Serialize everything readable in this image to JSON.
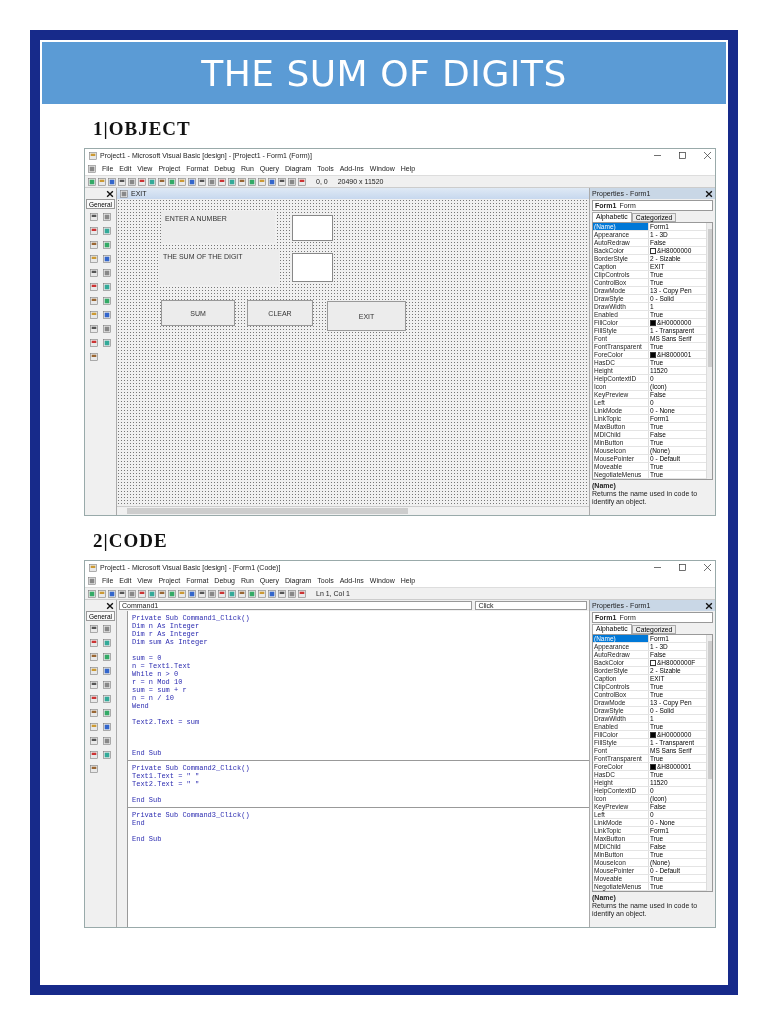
{
  "banner": {
    "title": "THE SUM OF DIGITS"
  },
  "sections": [
    {
      "heading": "1|OBJECT",
      "ide": {
        "kind": "form",
        "title": "Project1 - Microsoft Visual Basic [design] - [Project1 - Form1 (Form)]",
        "menu": [
          "File",
          "Edit",
          "View",
          "Project",
          "Format",
          "Debug",
          "Run",
          "Query",
          "Diagram",
          "Tools",
          "Add-Ins",
          "Window",
          "Help"
        ],
        "status": [
          "0, 0",
          "20490 x 11520"
        ],
        "toolbox_tab": "General",
        "form": {
          "caption": "EXIT",
          "controls": [
            {
              "kind": "label",
              "text": "ENTER A NUMBER"
            },
            {
              "kind": "textbox"
            },
            {
              "kind": "label",
              "text": "THE SUM OF THE DIGIT"
            },
            {
              "kind": "textbox"
            },
            {
              "kind": "button",
              "text": "SUM"
            },
            {
              "kind": "button",
              "text": "CLEAR"
            },
            {
              "kind": "button",
              "text": "EXIT"
            }
          ]
        },
        "properties": {
          "title": "Properties - Form1",
          "object": "Form1",
          "object_type": "Form",
          "tabs": [
            {
              "label": "Alphabetic",
              "selected": true
            },
            {
              "label": "Categorized",
              "selected": false
            }
          ],
          "rows": [
            {
              "name": "(Name)",
              "value": "Form1",
              "selected": true
            },
            {
              "name": "Appearance",
              "value": "1 - 3D",
              "selected": false
            },
            {
              "name": "AutoRedraw",
              "value": "False",
              "selected": false
            },
            {
              "name": "BackColor",
              "value": "&H8000000",
              "color": "#ffffff",
              "selected": false
            },
            {
              "name": "BorderStyle",
              "value": "2 - Sizable",
              "selected": false
            },
            {
              "name": "Caption",
              "value": "EXIT",
              "selected": false
            },
            {
              "name": "ClipControls",
              "value": "True",
              "selected": false
            },
            {
              "name": "ControlBox",
              "value": "True",
              "selected": false
            },
            {
              "name": "DrawMode",
              "value": "13 - Copy Pen",
              "selected": false
            },
            {
              "name": "DrawStyle",
              "value": "0 - Solid",
              "selected": false
            },
            {
              "name": "DrawWidth",
              "value": "1",
              "selected": false
            },
            {
              "name": "Enabled",
              "value": "True",
              "selected": false
            },
            {
              "name": "FillColor",
              "value": "&H0000000",
              "color": "#000000",
              "selected": false
            },
            {
              "name": "FillStyle",
              "value": "1 - Transparent",
              "selected": false
            },
            {
              "name": "Font",
              "value": "MS Sans Serif",
              "selected": false
            },
            {
              "name": "FontTransparent",
              "value": "True",
              "selected": false
            },
            {
              "name": "ForeColor",
              "value": "&H8000001",
              "color": "#000000",
              "selected": false
            },
            {
              "name": "HasDC",
              "value": "True",
              "selected": false
            },
            {
              "name": "Height",
              "value": "11520",
              "selected": false
            },
            {
              "name": "HelpContextID",
              "value": "0",
              "selected": false
            },
            {
              "name": "Icon",
              "value": "(Icon)",
              "selected": false
            },
            {
              "name": "KeyPreview",
              "value": "False",
              "selected": false
            },
            {
              "name": "Left",
              "value": "0",
              "selected": false
            },
            {
              "name": "LinkMode",
              "value": "0 - None",
              "selected": false
            },
            {
              "name": "LinkTopic",
              "value": "Form1",
              "selected": false
            },
            {
              "name": "MaxButton",
              "value": "True",
              "selected": false
            },
            {
              "name": "MDIChild",
              "value": "False",
              "selected": false
            },
            {
              "name": "MinButton",
              "value": "True",
              "selected": false
            },
            {
              "name": "MouseIcon",
              "value": "(None)",
              "selected": false
            },
            {
              "name": "MousePointer",
              "value": "0 - Default",
              "selected": false
            },
            {
              "name": "Moveable",
              "value": "True",
              "selected": false
            },
            {
              "name": "NegotiateMenus",
              "value": "True",
              "selected": false
            }
          ],
          "description_title": "(Name)",
          "description": "Returns the name used in code to identify an object."
        }
      }
    },
    {
      "heading": "2|CODE",
      "ide": {
        "kind": "code",
        "title": "Project1 - Microsoft Visual Basic [design] - [Form1 (Code)]",
        "menu": [
          "File",
          "Edit",
          "View",
          "Project",
          "Format",
          "Debug",
          "Run",
          "Query",
          "Diagram",
          "Tools",
          "Add-Ins",
          "Window",
          "Help"
        ],
        "status": [
          "Ln 1, Col 1"
        ],
        "toolbox_tab": "General",
        "code": {
          "object": "Command1",
          "procedure": "Click",
          "blocks": [
            {
              "paragraphs": [
                [
                  "Private Sub Command1_Click()",
                  "Dim n As Integer",
                  "Dim r As Integer",
                  "Dim sum As Integer"
                ],
                [
                  "sum = 0",
                  "n = Text1.Text",
                  "While n > 0",
                  "r = n Mod 10",
                  "sum = sum + r",
                  "n = n / 10",
                  "Wend"
                ],
                [
                  "Text2.Text = sum"
                ],
                [
                  "End Sub"
                ]
              ]
            },
            {
              "paragraphs": [
                [
                  "Private Sub Command2_Click()",
                  "Text1.Text = \" \"",
                  "Text2.Text = \" \""
                ],
                [
                  "End Sub"
                ]
              ]
            },
            {
              "paragraphs": [
                [
                  "Private Sub Command3_Click()",
                  "End"
                ],
                [
                  "End Sub"
                ]
              ]
            }
          ]
        },
        "properties": {
          "title": "Properties - Form1",
          "object": "Form1",
          "object_type": "Form",
          "tabs": [
            {
              "label": "Alphabetic",
              "selected": true
            },
            {
              "label": "Categorized",
              "selected": false
            }
          ],
          "rows": [
            {
              "name": "(Name)",
              "value": "Form1",
              "selected": true
            },
            {
              "name": "Appearance",
              "value": "1 - 3D",
              "selected": false
            },
            {
              "name": "AutoRedraw",
              "value": "False",
              "selected": false
            },
            {
              "name": "BackColor",
              "value": "&H8000000F",
              "color": "#ffffff",
              "selected": false
            },
            {
              "name": "BorderStyle",
              "value": "2 - Sizable",
              "selected": false
            },
            {
              "name": "Caption",
              "value": "EXIT",
              "selected": false
            },
            {
              "name": "ClipControls",
              "value": "True",
              "selected": false
            },
            {
              "name": "ControlBox",
              "value": "True",
              "selected": false
            },
            {
              "name": "DrawMode",
              "value": "13 - Copy Pen",
              "selected": false
            },
            {
              "name": "DrawStyle",
              "value": "0 - Solid",
              "selected": false
            },
            {
              "name": "DrawWidth",
              "value": "1",
              "selected": false
            },
            {
              "name": "Enabled",
              "value": "True",
              "selected": false
            },
            {
              "name": "FillColor",
              "value": "&H0000000",
              "color": "#000000",
              "selected": false
            },
            {
              "name": "FillStyle",
              "value": "1 - Transparent",
              "selected": false
            },
            {
              "name": "Font",
              "value": "MS Sans Serif",
              "selected": false
            },
            {
              "name": "FontTransparent",
              "value": "True",
              "selected": false
            },
            {
              "name": "ForeColor",
              "value": "&H8000001",
              "color": "#000000",
              "selected": false
            },
            {
              "name": "HasDC",
              "value": "True",
              "selected": false
            },
            {
              "name": "Height",
              "value": "11520",
              "selected": false
            },
            {
              "name": "HelpContextID",
              "value": "0",
              "selected": false
            },
            {
              "name": "Icon",
              "value": "(Icon)",
              "selected": false
            },
            {
              "name": "KeyPreview",
              "value": "False",
              "selected": false
            },
            {
              "name": "Left",
              "value": "0",
              "selected": false
            },
            {
              "name": "LinkMode",
              "value": "0 - None",
              "selected": false
            },
            {
              "name": "LinkTopic",
              "value": "Form1",
              "selected": false
            },
            {
              "name": "MaxButton",
              "value": "True",
              "selected": false
            },
            {
              "name": "MDIChild",
              "value": "False",
              "selected": false
            },
            {
              "name": "MinButton",
              "value": "True",
              "selected": false
            },
            {
              "name": "MouseIcon",
              "value": "(None)",
              "selected": false
            },
            {
              "name": "MousePointer",
              "value": "0 - Default",
              "selected": false
            },
            {
              "name": "Moveable",
              "value": "True",
              "selected": false
            },
            {
              "name": "NegotiateMenus",
              "value": "True",
              "selected": false
            }
          ],
          "description_title": "(Name)",
          "description": "Returns the name used in code to identify an object."
        }
      }
    }
  ]
}
